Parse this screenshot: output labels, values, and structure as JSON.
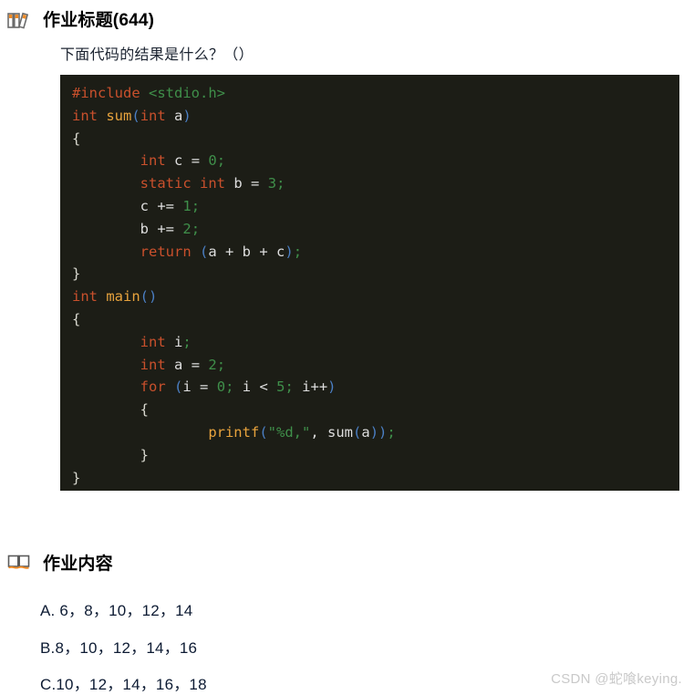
{
  "sections": {
    "title": {
      "icon": "books-icon",
      "label": "作业标题(644)"
    },
    "content": {
      "icon": "open-book-icon",
      "label": "作业内容"
    }
  },
  "question": {
    "text": "下面代码的结果是什么？（）"
  },
  "code": {
    "language": "c",
    "background": "#1c1d16",
    "lines": [
      "#include <stdio.h>",
      "int sum(int a)",
      "{",
      "        int c = 0;",
      "        static int b = 3;",
      "        c += 1;",
      "        b += 2;",
      "        return (a + b + c);",
      "}",
      "int main()",
      "{",
      "        int i;",
      "        int a = 2;",
      "        for (i = 0; i < 5; i++)",
      "        {",
      "                printf(\"%d,\", sum(a));",
      "        }",
      "}"
    ],
    "colors": {
      "keyword": "#c9502c",
      "function": "#e8a33d",
      "string": "#3f8f4a",
      "number": "#3f8f4a",
      "paren": "#4b7fc4",
      "plain": "#dedede"
    }
  },
  "options": [
    {
      "key": "A",
      "text": "A. 6，8，10，12，14"
    },
    {
      "key": "B",
      "text": "B.8，10，12，14，16"
    },
    {
      "key": "C",
      "text": "C.10，12，14，16，18"
    }
  ],
  "watermark": {
    "text": "CSDN @蛇喰keying."
  }
}
